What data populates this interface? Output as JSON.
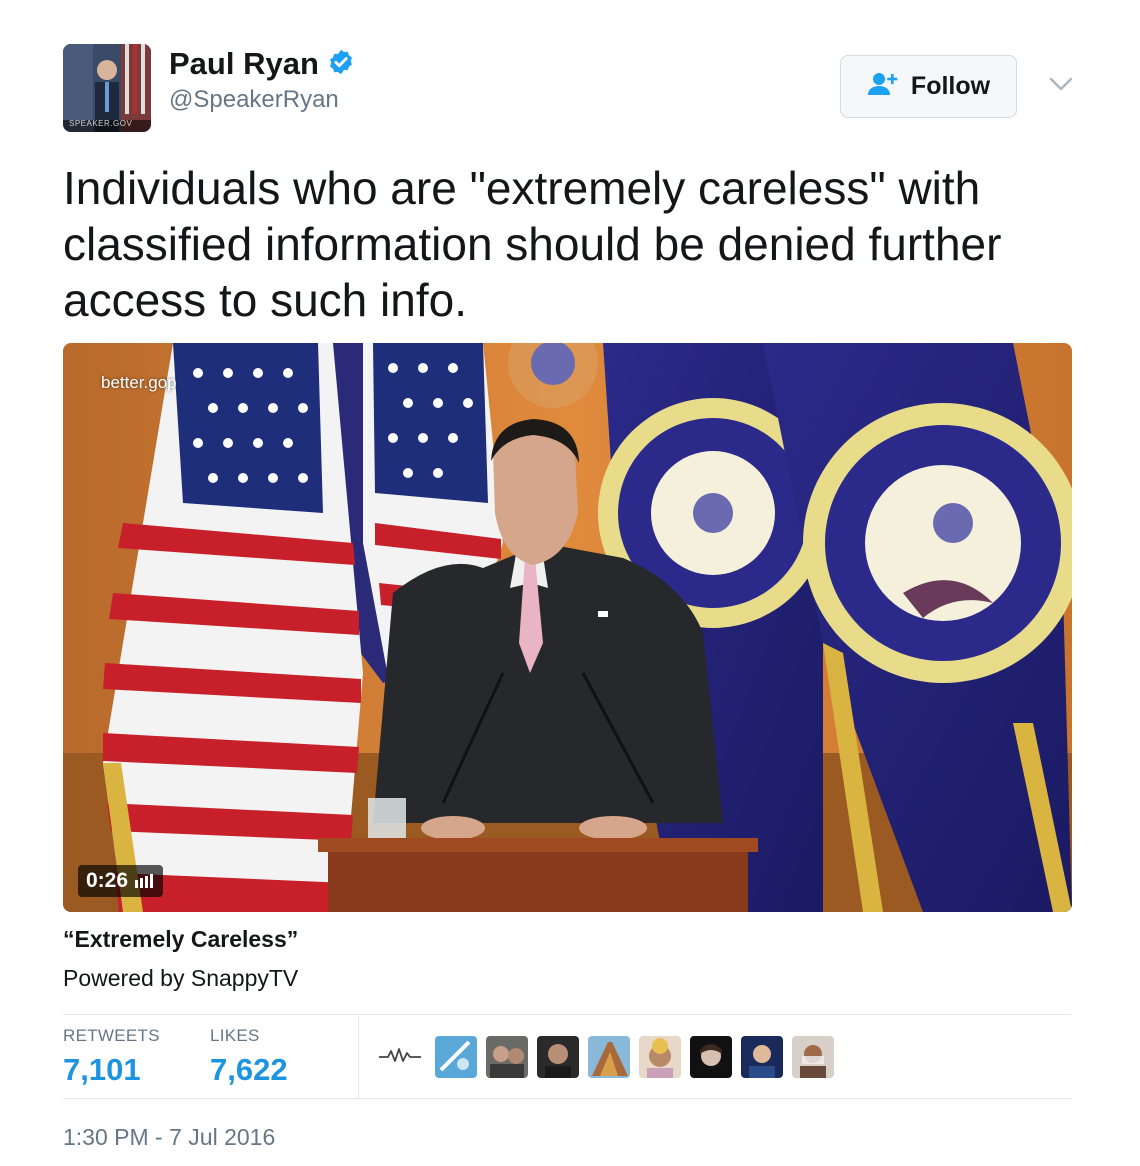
{
  "author": {
    "name": "Paul Ryan",
    "handle": "@SpeakerRyan",
    "verified": true,
    "avatar_caption": "SPEAKER.GOV"
  },
  "follow_button": {
    "label": "Follow",
    "icon": "add-user-icon"
  },
  "menu": {
    "icon": "chevron-down-icon"
  },
  "tweet": {
    "text": "Individuals who are \"extremely careless\" with classified information should be denied further access to such info."
  },
  "video": {
    "watermark": "better.gop",
    "duration": "0:26",
    "title": "“Extremely Careless”",
    "powered_by": "Powered by SnappyTV"
  },
  "stats": {
    "retweets_label": "RETWEETS",
    "retweets_count": "7,101",
    "likes_label": "LIKES",
    "likes_count": "7,622"
  },
  "likers_icon": "activity-icon",
  "timestamp": "1:30 PM - 7 Jul 2016",
  "colors": {
    "link_blue": "#1c94e0",
    "verified_blue": "#1da1f2",
    "muted_gray": "#657786",
    "border_gray": "#e1e8ed"
  }
}
